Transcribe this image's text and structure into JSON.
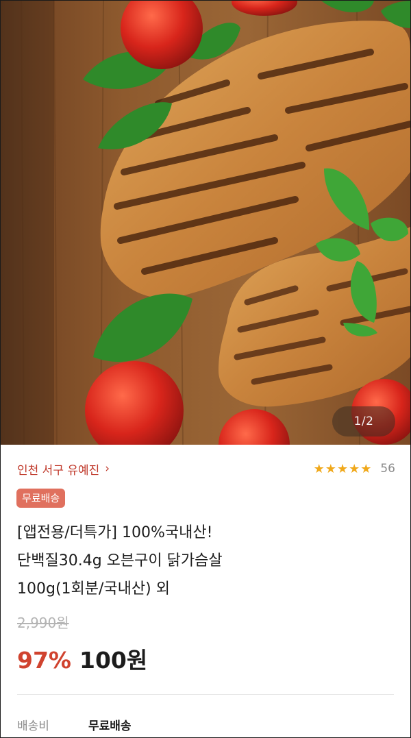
{
  "gallery": {
    "pager": "1/2"
  },
  "seller": {
    "name": "인천 서구 유예진",
    "chevron": "›"
  },
  "rating": {
    "stars": "★★★★★",
    "count": "56"
  },
  "badge": {
    "label": "무료배송"
  },
  "product": {
    "title_lines": [
      "[앱전용/더특가] 100%국내산!",
      "단백질30.4g 오븐구이 닭가슴살",
      "100g(1회분/국내산) 외"
    ],
    "original_price": "2,990원",
    "discount": "97%",
    "price": "100원"
  },
  "shipping": {
    "label": "배송비",
    "value": "무료배송"
  },
  "colors": {
    "accent": "#d0432f",
    "badge": "#e0705e",
    "star": "#f0a81a"
  }
}
